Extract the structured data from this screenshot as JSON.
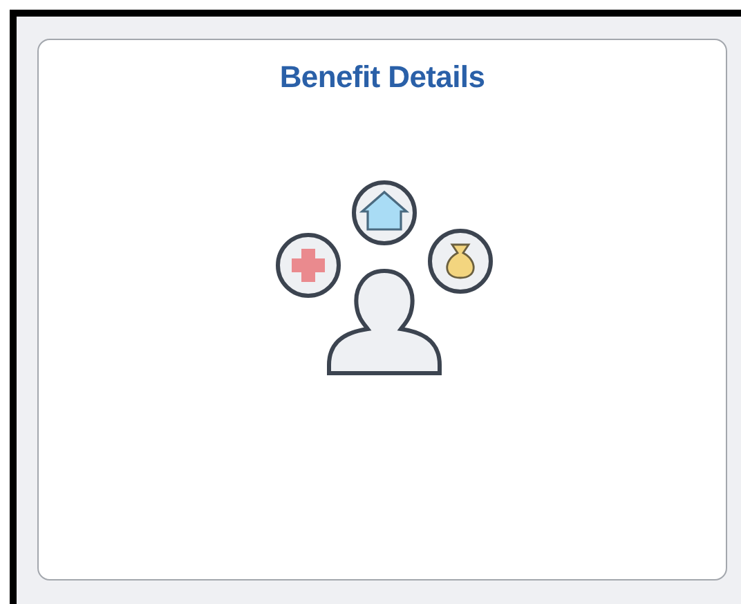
{
  "tile": {
    "title": "Benefit Details"
  }
}
